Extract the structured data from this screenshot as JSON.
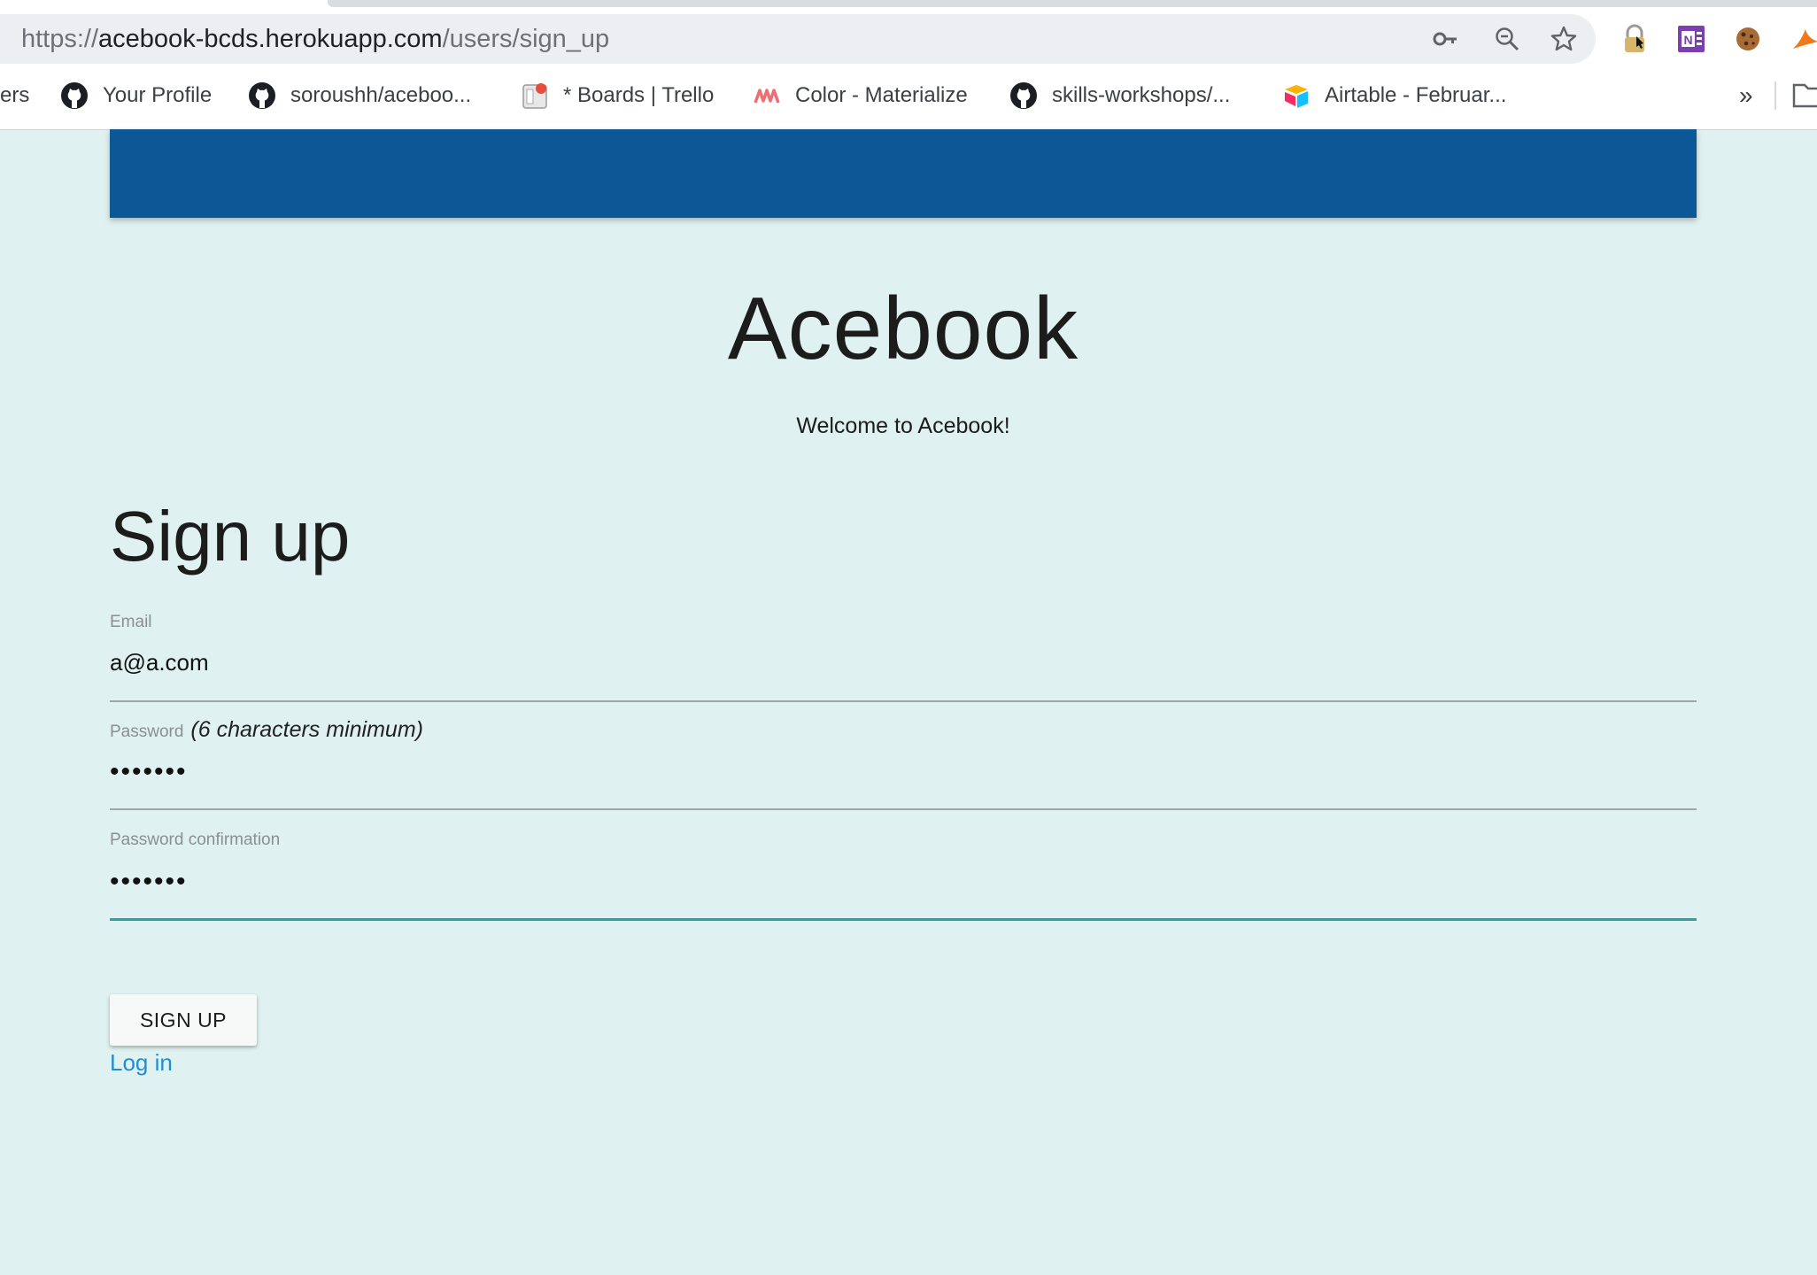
{
  "browser": {
    "url": {
      "scheme": "https://",
      "host": "acebook-bcds.herokuapp.com",
      "path": "/users/sign_up"
    },
    "omnibox_icons": [
      "key-icon",
      "zoom-out-icon",
      "star-icon"
    ],
    "extension_icons": [
      "lock-extension-icon",
      "onenote-icon",
      "cookie-icon",
      "fox-extension-icon"
    ],
    "bookmarks": [
      {
        "label": "ers",
        "icon": "none"
      },
      {
        "label": "Your Profile",
        "icon": "github-icon"
      },
      {
        "label": "soroushh/aceboo...",
        "icon": "github-icon"
      },
      {
        "label": "* Boards | Trello",
        "icon": "trello-icon"
      },
      {
        "label": "Color - Materialize",
        "icon": "materialize-icon"
      },
      {
        "label": "skills-workshops/...",
        "icon": "github-icon"
      },
      {
        "label": "Airtable - Februar...",
        "icon": "airtable-icon"
      }
    ],
    "bookmarks_overflow": "»"
  },
  "page": {
    "navbar_color": "#0c5896",
    "background_color": "#dff1f0",
    "site_title": "Acebook",
    "welcome": "Welcome to Acebook!",
    "heading": "Sign up",
    "form": {
      "email": {
        "label": "Email",
        "value": "a@a.com"
      },
      "password": {
        "label": "Password",
        "hint": "(6 characters minimum)",
        "value": "•••••••"
      },
      "password_confirmation": {
        "label": "Password confirmation",
        "value": "•••••••"
      },
      "submit_label": "SIGN UP",
      "login_link": "Log in"
    },
    "accent_color": "#26a69a",
    "link_color": "#1e8fd6"
  }
}
